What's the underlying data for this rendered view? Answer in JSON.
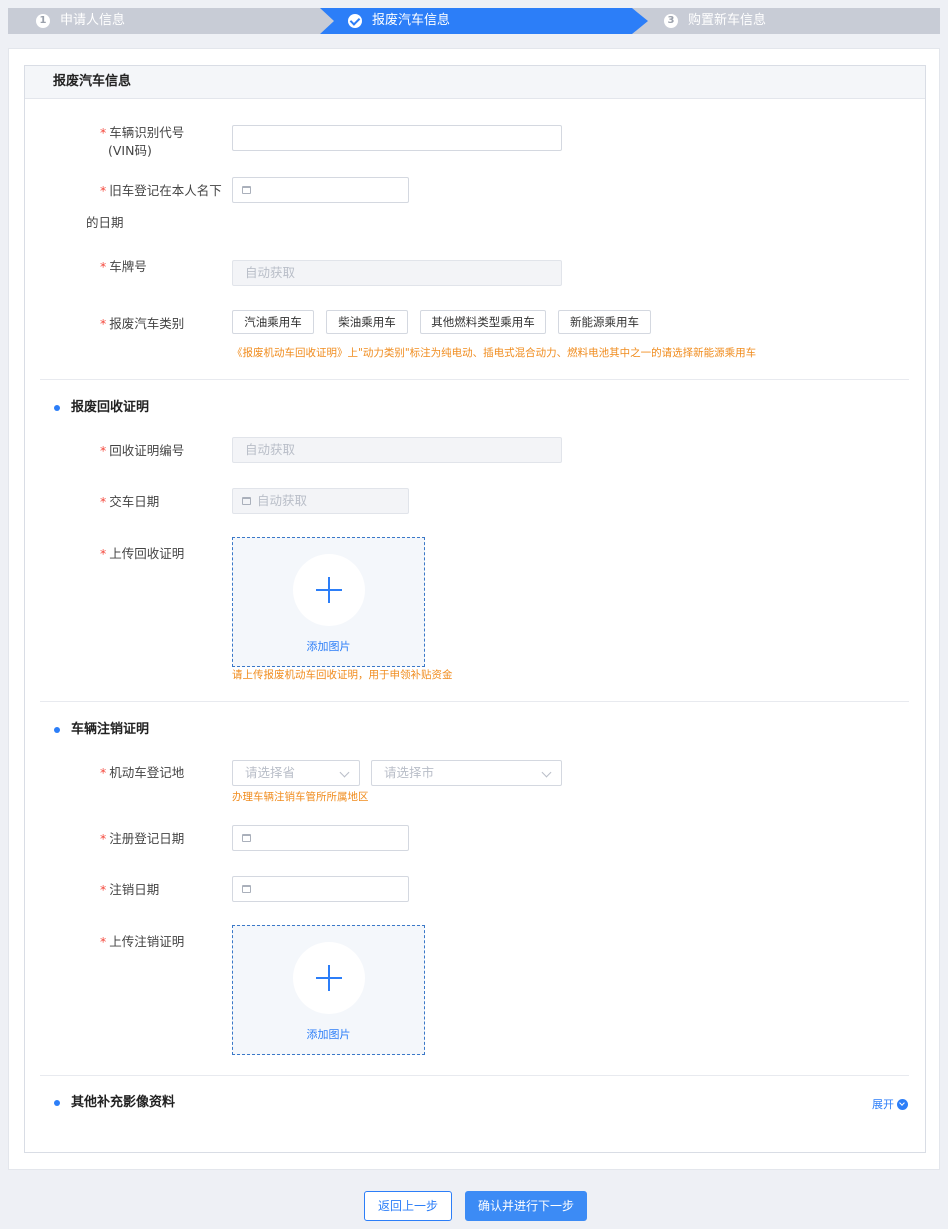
{
  "steps": [
    {
      "num": "1",
      "label": "申请人信息"
    },
    {
      "num": "",
      "label": "报废汽车信息"
    },
    {
      "num": "3",
      "label": "购置新车信息"
    }
  ],
  "panel_title": "报废汽车信息",
  "vehicle": {
    "vin_label": "车辆识别代号",
    "vin_label2": "(VIN码)",
    "reg_label": "旧车登记在本人名下",
    "reg_label2": "的日期",
    "plate_label": "车牌号",
    "plate_placeholder": "自动获取",
    "category_label": "报废汽车类别",
    "categories": [
      "汽油乘用车",
      "柴油乘用车",
      "其他燃料类型乘用车",
      "新能源乘用车"
    ],
    "category_hint": "《报废机动车回收证明》上\"动力类别\"标注为纯电动、插电式混合动力、燃料电池其中之一的请选择新能源乘用车"
  },
  "recycle": {
    "title": "报废回收证明",
    "number_label": "回收证明编号",
    "number_placeholder": "自动获取",
    "date_label": "交车日期",
    "date_placeholder": "自动获取",
    "upload_label": "上传回收证明",
    "upload_text": "添加图片",
    "upload_hint": "请上传报废机动车回收证明，用于申领补贴资金"
  },
  "cancel": {
    "title": "车辆注销证明",
    "place_label": "机动车登记地",
    "province_placeholder": "请选择省",
    "city_placeholder": "请选择市",
    "place_hint": "办理车辆注销车管所所属地区",
    "reg_date_label": "注册登记日期",
    "cancel_date_label": "注销日期",
    "upload_label": "上传注销证明",
    "upload_text": "添加图片"
  },
  "other": {
    "title": "其他补充影像资料",
    "expand_label": "展开"
  },
  "buttons": {
    "back": "返回上一步",
    "next": "确认并进行下一步"
  },
  "colors": {
    "primary": "#2c7ef8",
    "warning_text": "#f08c1e",
    "required": "#f5493d"
  }
}
